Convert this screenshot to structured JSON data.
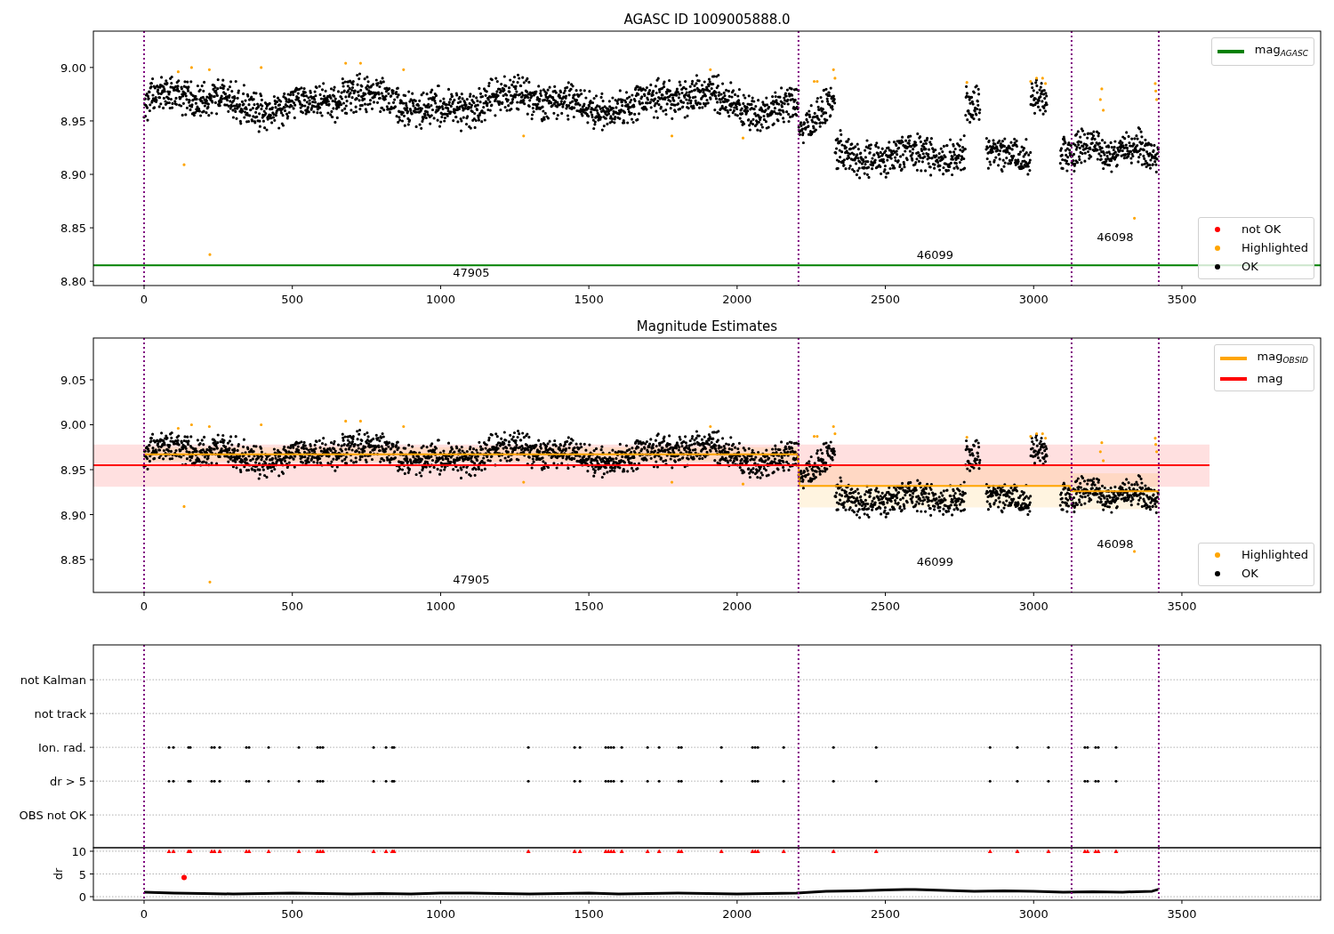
{
  "figure": {
    "panels": [
      {
        "kind": "magnitude",
        "chart_data": {
          "type": "line",
          "title": "AGASC ID 1009005888.0",
          "xlim": [
            -171,
            3968
          ],
          "ylim": [
            8.796,
            9.034
          ],
          "xticks": [
            0,
            500,
            1000,
            1500,
            2000,
            2500,
            3000,
            3500
          ],
          "yticks": [
            {
              "value": 8.8,
              "label": "8.80"
            },
            {
              "value": 8.85,
              "label": "8.85"
            },
            {
              "value": 8.9,
              "label": "8.90"
            },
            {
              "value": 8.95,
              "label": "8.95"
            },
            {
              "value": 9.0,
              "label": "9.00"
            }
          ],
          "series": [
            {
              "name": "mag$_{AGASC}$",
              "color": "#008000",
              "x": [
                -171,
                3968
              ],
              "values": [
                8.815,
                8.815
              ]
            }
          ],
          "ref_lines": [
            {
              "axis": "x",
              "value": 0
            },
            {
              "axis": "x",
              "value": 2207
            },
            {
              "axis": "x",
              "value": 3128
            },
            {
              "axis": "x",
              "value": 3422
            }
          ],
          "annotations": [
            "47905",
            "46099",
            "46098"
          ]
        },
        "legend_markers": [
          {
            "label": "not OK",
            "color": "#ff0000"
          },
          {
            "label": "Highlighted",
            "color": "#ffa500"
          },
          {
            "label": "OK",
            "color": "#000000"
          }
        ]
      },
      {
        "kind": "magnitude",
        "chart_data": {
          "type": "line",
          "title": "Magnitude Estimates",
          "xlim": [
            -171,
            3968
          ],
          "ylim": [
            8.8134,
            9.0965
          ],
          "xticks": [
            0,
            500,
            1000,
            1500,
            2000,
            2500,
            3000,
            3500
          ],
          "yticks": [
            {
              "value": 8.85,
              "label": "8.85"
            },
            {
              "value": 8.9,
              "label": "8.90"
            },
            {
              "value": 8.95,
              "label": "8.95"
            },
            {
              "value": 9.0,
              "label": "9.00"
            },
            {
              "value": 9.05,
              "label": "9.05"
            }
          ],
          "series": [
            {
              "name": "mag$_{OBSID}$",
              "color": "#ffa500",
              "x": [
                0,
                2205,
                2210,
                3122,
                3128,
                3422
              ],
              "values": [
                8.967,
                8.967,
                8.932,
                8.932,
                8.926,
                8.926
              ]
            },
            {
              "name": "mag",
              "color": "#ff0000",
              "x": [
                -171,
                3593
              ],
              "values": [
                8.955,
                8.955
              ]
            }
          ],
          "bands": [
            {
              "axis": "y",
              "from": 8.931,
              "to": 8.978,
              "color": "#ff0000"
            },
            {
              "axis": "y",
              "from": 8.959,
              "to": 8.975,
              "color": "#ffa500"
            },
            {
              "axis": "y",
              "from": 8.908,
              "to": 8.956,
              "color": "#ffa500"
            },
            {
              "axis": "y",
              "from": 8.906,
              "to": 8.946,
              "color": "#ffa500"
            }
          ],
          "ref_lines": [
            {
              "axis": "x",
              "value": 0
            },
            {
              "axis": "x",
              "value": 2207
            },
            {
              "axis": "x",
              "value": 3128
            },
            {
              "axis": "x",
              "value": 3422
            }
          ],
          "annotations": [
            "47905",
            "46099",
            "46098"
          ]
        },
        "legend_markers": [
          {
            "label": "Highlighted",
            "color": "#ffa500"
          },
          {
            "label": "OK",
            "color": "#000000"
          }
        ]
      },
      {
        "kind": "flags",
        "row_labels": [
          "not Kalman",
          "not track",
          "Ion. rad.",
          "dr > 5",
          "OBS not OK"
        ]
      },
      {
        "kind": "dr",
        "chart_data": {
          "type": "scatter",
          "ylabel": "dr",
          "grid": true,
          "xlim": [
            -171,
            3968
          ],
          "ylim": [
            -0.78,
            10.78
          ],
          "xticks": [
            0,
            500,
            1000,
            1500,
            2000,
            2500,
            3000,
            3500
          ],
          "yticks": [
            0,
            5,
            10
          ],
          "series": [
            {
              "type": "line",
              "color": "#000000",
              "x": [
                0,
                100,
                200,
                300,
                400,
                500,
                600,
                700,
                800,
                900,
                1000,
                1100,
                1200,
                1300,
                1400,
                1500,
                1600,
                1700,
                1800,
                1900,
                2000,
                2100,
                2200,
                2300,
                2400,
                2500,
                2600,
                2700,
                2800,
                2900,
                3000,
                3100,
                3200,
                3300,
                3400,
                3420
              ],
              "values": [
                1.0,
                0.8,
                0.7,
                0.6,
                0.7,
                0.8,
                0.7,
                0.6,
                0.7,
                0.6,
                0.8,
                0.8,
                0.7,
                0.6,
                0.7,
                0.8,
                0.6,
                0.7,
                0.8,
                0.7,
                0.6,
                0.7,
                0.8,
                1.2,
                1.3,
                1.5,
                1.6,
                1.4,
                1.2,
                1.3,
                1.2,
                1.0,
                1.1,
                1.0,
                1.2,
                1.6
              ]
            },
            {
              "marker": "triangle",
              "color": "#ff0000",
              "x": [
                84,
                99,
                150,
                156,
                228,
                237,
                255,
                345,
                354,
                420,
                522,
                585,
                594,
                603,
                774,
                816,
                837,
                843,
                1296,
                1452,
                1470,
                1557,
                1566,
                1575,
                1584,
                1611,
                1698,
                1737,
                1803,
                1812,
                1947,
                2052,
                2061,
                2070,
                2157,
                2325,
                2469,
                2853,
                2945,
                3050,
                3173,
                3182,
                3209,
                3218,
                3278
              ],
              "values": [
                10,
                10,
                10,
                10,
                10,
                10,
                10,
                10,
                10,
                10,
                10,
                10,
                10,
                10,
                10,
                10,
                10,
                10,
                10,
                10,
                10,
                10,
                10,
                10,
                10,
                10,
                10,
                10,
                10,
                10,
                10,
                10,
                10,
                10,
                10,
                10,
                10,
                10,
                10,
                10,
                10,
                10,
                10,
                10,
                10
              ]
            },
            {
              "marker": "circle",
              "color": "#ff0000",
              "x": [
                135
              ],
              "values": [
                4.2
              ]
            }
          ],
          "ref_lines": [
            {
              "axis": "x",
              "value": 0
            },
            {
              "axis": "x",
              "value": 2207
            },
            {
              "axis": "x",
              "value": 3128
            },
            {
              "axis": "x",
              "value": 3422
            }
          ]
        }
      }
    ]
  }
}
